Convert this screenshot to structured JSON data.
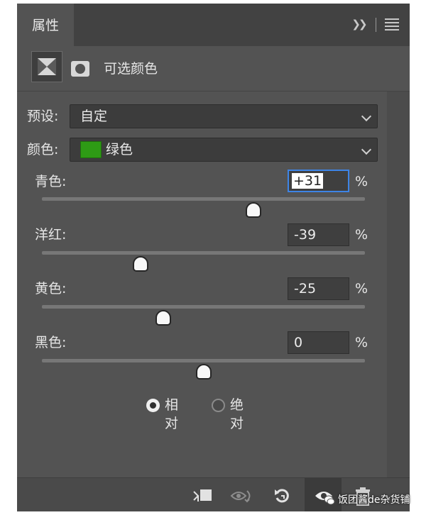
{
  "panel": {
    "tab_label": "属性",
    "collapse_label": "›› "
  },
  "header": {
    "adjustment_title": "可选颜色"
  },
  "preset": {
    "label": "预设:",
    "value": "自定"
  },
  "colors": {
    "label": "颜色:",
    "value": "绿色",
    "swatch_color": "#2e9b15"
  },
  "sliders": [
    {
      "label": "青色:",
      "value": "+31",
      "unit": "%",
      "position_pct": 65.5
    },
    {
      "label": "洋红:",
      "value": "-39",
      "unit": "%",
      "position_pct": 30.5
    },
    {
      "label": "黄色:",
      "value": "-25",
      "unit": "%",
      "position_pct": 37.5
    },
    {
      "label": "黑色:",
      "value": "0",
      "unit": "%",
      "position_pct": 50
    }
  ],
  "method": {
    "relative_label": "相对",
    "absolute_label": "绝对",
    "selected": "relative"
  },
  "watermark": "饭团酱de杂货铺"
}
